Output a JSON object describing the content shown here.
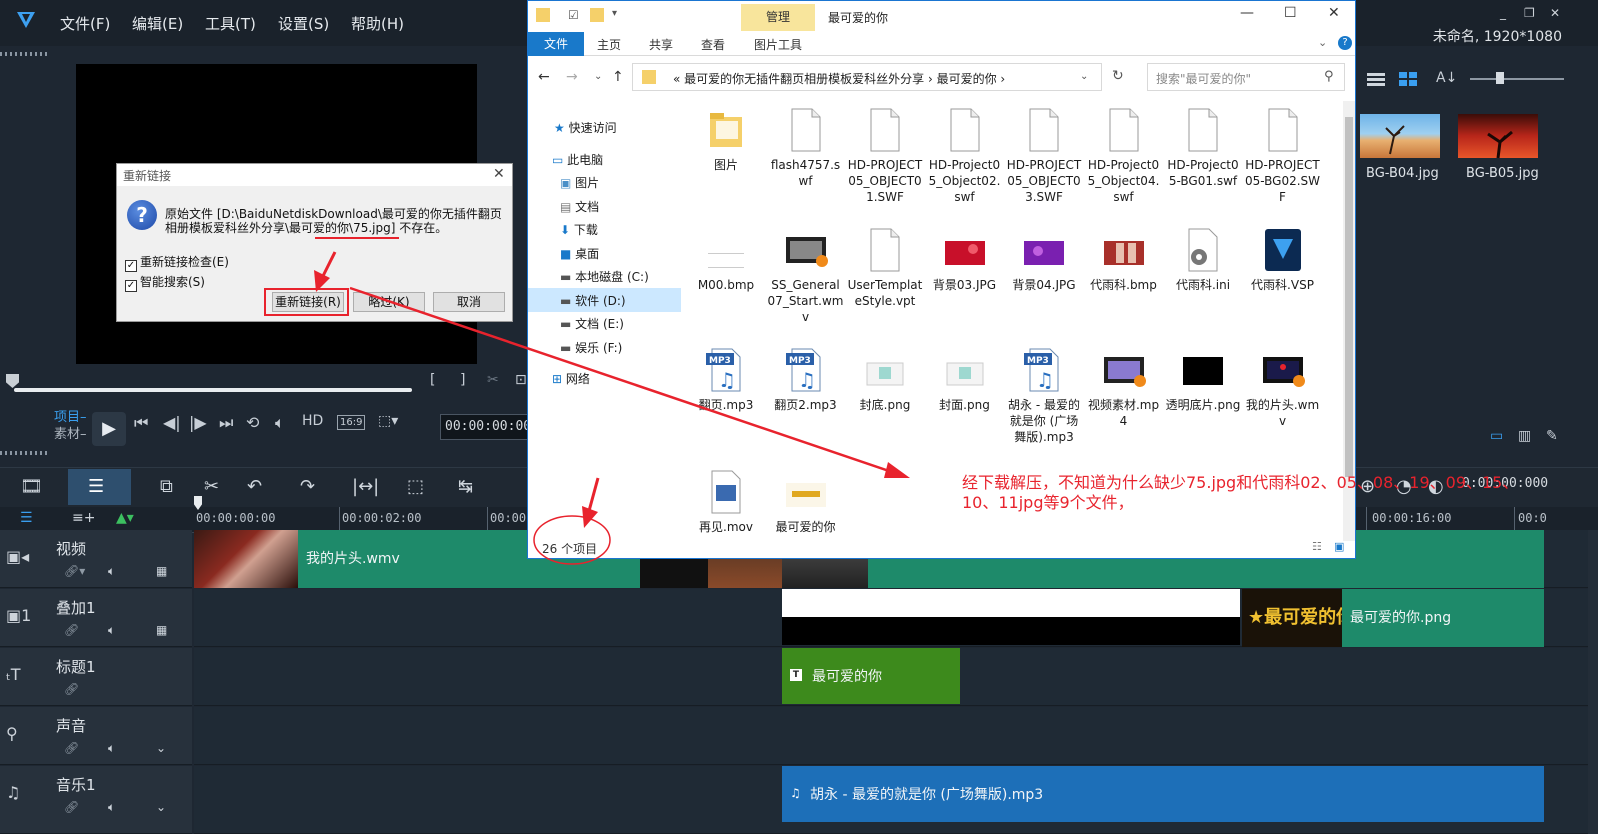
{
  "app": {
    "menu": [
      "文件(F)",
      "编辑(E)",
      "工具(T)",
      "设置(S)",
      "帮助(H)"
    ],
    "project_info": "未命名, 1920*1080",
    "window_controls": [
      "_",
      "❐",
      "✕"
    ]
  },
  "player": {
    "mode_project": "项目",
    "mode_clip": "素材",
    "timecode": "00:00:00:000",
    "hd": "HD",
    "aspect": "16:9"
  },
  "timeline": {
    "ruler": [
      "00:00:00:00",
      "00:00:02:00",
      "00:00:",
      "00:00:16:00",
      "00:0"
    ],
    "timecode": "0:00:00:000",
    "tracks": [
      {
        "name": "视频",
        "icon": "video-track-icon"
      },
      {
        "name": "叠加1",
        "icon": "overlay-track-icon"
      },
      {
        "name": "标题1",
        "icon": "title-track-icon"
      },
      {
        "name": "声音",
        "icon": "voice-track-icon"
      },
      {
        "name": "音乐1",
        "icon": "music-track-icon"
      }
    ],
    "clips": {
      "video_main": "我的片头.wmv",
      "overlay_png": "最可爱的你.png",
      "overlay_thumb_text": "最可爱的你",
      "title_clip": "最可爱的你",
      "music_clip": "胡永 - 最爱的就是你 (广场舞版).mp3"
    }
  },
  "library": {
    "thumbs": [
      {
        "label": "BG-B04.jpg"
      },
      {
        "label": "BG-B05.jpg"
      }
    ]
  },
  "dialog": {
    "title": "重新链接",
    "icon": "?",
    "message": "原始文件 [D:\\BaiduNetdiskDownload\\最可爱的你无插件翻页相册模板爱科丝外分享\\最可爱的你\\75.jpg] 不存在。",
    "check1": "重新链接检查(E)",
    "check2": "智能搜索(S)",
    "btn_relink": "重新链接(R)",
    "btn_skip": "略过(K)",
    "btn_cancel": "取消"
  },
  "explorer": {
    "window_title": "最可爱的你",
    "manage_tab": "管理",
    "ribbon_tabs": [
      "文件",
      "主页",
      "共享",
      "查看",
      "图片工具"
    ],
    "address": "«  最可爱的你无插件翻页相册模板爱科丝外分享  ›  最可爱的你  ›",
    "search_placeholder": "搜索\"最可爱的你\"",
    "nav": {
      "quick": "快速访问",
      "pc": "此电脑",
      "pictures": "图片",
      "docs": "文档",
      "downloads": "下载",
      "desktop": "桌面",
      "c": "本地磁盘 (C:)",
      "d": "软件 (D:)",
      "e": "文档 (E:)",
      "f": "娱乐 (F:)",
      "net": "网络"
    },
    "files": [
      {
        "name": "图片",
        "type": "folder"
      },
      {
        "name": "flash4757.swf",
        "type": "doc"
      },
      {
        "name": "HD-PROJECT05_OBJECT01.SWF",
        "type": "doc"
      },
      {
        "name": "HD-Project05_Object02.swf",
        "type": "doc"
      },
      {
        "name": "HD-PROJECT05_OBJECT03.SWF",
        "type": "doc"
      },
      {
        "name": "HD-Project05_Object04.swf",
        "type": "doc"
      },
      {
        "name": "HD-Project05-BG01.swf",
        "type": "doc"
      },
      {
        "name": "HD-PROJECT05-BG02.SWF",
        "type": "doc"
      },
      {
        "name": "M00.bmp",
        "type": "blank"
      },
      {
        "name": "SS_General07_Start.wmv",
        "type": "video"
      },
      {
        "name": "UserTemplateStyle.vpt",
        "type": "doc"
      },
      {
        "name": "背景03.JPG",
        "type": "img-red"
      },
      {
        "name": "背景04.JPG",
        "type": "img-purple"
      },
      {
        "name": "代雨科.bmp",
        "type": "img-photo"
      },
      {
        "name": "代雨科.ini",
        "type": "ini"
      },
      {
        "name": "代雨科.VSP",
        "type": "vsp"
      },
      {
        "name": "翻页.mp3",
        "type": "mp3"
      },
      {
        "name": "翻页2.mp3",
        "type": "mp3"
      },
      {
        "name": "封底.png",
        "type": "png"
      },
      {
        "name": "封面.png",
        "type": "png"
      },
      {
        "name": "胡永 - 最爱的就是你 (广场舞版).mp3",
        "type": "mp3"
      },
      {
        "name": "视频素材.mp4",
        "type": "video2"
      },
      {
        "name": "透明底片.png",
        "type": "black"
      },
      {
        "name": "我的片头.wmv",
        "type": "video3"
      },
      {
        "name": "再见.mov",
        "type": "mov"
      },
      {
        "name": "最可爱的你",
        "type": "gold"
      }
    ],
    "status": "26 个项目"
  },
  "annotation": {
    "note": "经下载解压，不知道为什么缺少75.jpg和代雨科02、05、08、19、09、15、10、11jpg等9个文件，",
    "color": "#e8232d"
  }
}
